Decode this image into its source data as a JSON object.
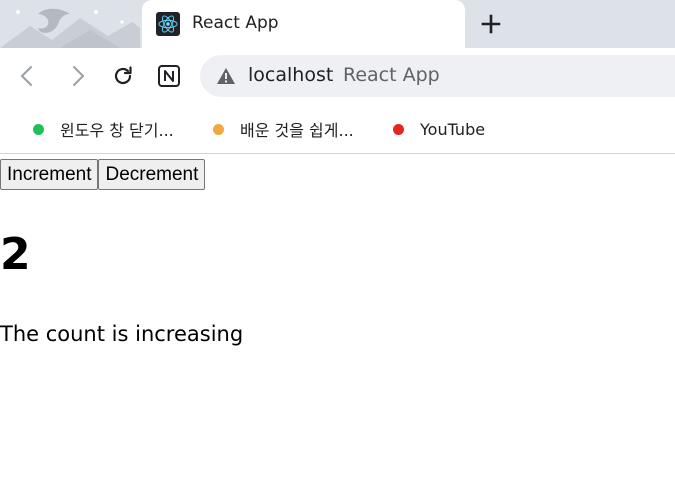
{
  "browser": {
    "tab": {
      "title": "React App",
      "favicon": "react-logo-icon"
    },
    "new_tab_icon": "plus-icon",
    "toolbar": {
      "back_icon": "back-arrow-icon",
      "forward_icon": "forward-arrow-icon",
      "reload_icon": "reload-icon",
      "extension_icon": "n-extension-icon"
    },
    "omnibox": {
      "security_icon": "warning-icon",
      "host": "localhost",
      "page_title": "React App"
    },
    "bookmarks": [
      {
        "label": "윈도우 창 닫기...",
        "color": "#1fbf5a"
      },
      {
        "label": "배운 것을 쉽게...",
        "color": "#f0a742"
      },
      {
        "label": "YouTube",
        "color": "#e52620"
      }
    ]
  },
  "app": {
    "increment_label": "Increment",
    "decrement_label": "Decrement",
    "count": "2",
    "status": "The count is increasing"
  }
}
